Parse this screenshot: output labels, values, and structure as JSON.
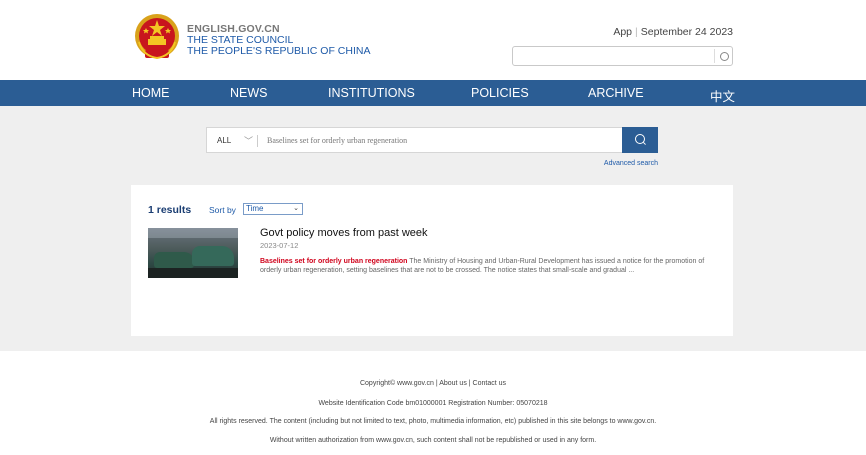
{
  "brand": {
    "site": "ENGLISH.GOV.CN",
    "line1": "THE STATE COUNCIL",
    "line2": "THE PEOPLE'S REPUBLIC OF CHINA"
  },
  "topbar": {
    "app_label": "App",
    "date": "September 24 2023",
    "search_placeholder": ""
  },
  "nav": {
    "items": [
      "HOME",
      "NEWS",
      "INSTITUTIONS",
      "POLICIES",
      "ARCHIVE",
      "中文"
    ]
  },
  "search": {
    "scope": "ALL",
    "query": "Baselines set for orderly urban regeneration",
    "advanced_label": "Advanced search"
  },
  "results": {
    "count_label": "1 results",
    "sort_label": "Sort by",
    "sort_value": "Time",
    "items": [
      {
        "title": "Govt policy moves from past week",
        "date": "2023-07-12",
        "highlight": "Baselines set for orderly urban regeneration",
        "snippet": " The Ministry of Housing and Urban-Rural Development has issued a notice for the promotion of orderly urban regeneration, setting baselines that are not to be crossed. The notice states that small-scale and gradual ..."
      }
    ]
  },
  "footer": {
    "line1": "Copyright© www.gov.cn | About us | Contact us",
    "line2": "Website Identification Code bm01000001     Registration Number: 05070218",
    "line3": "All rights reserved. The content (including but not limited to text, photo, multimedia information, etc) published in this site belongs to www.gov.cn.",
    "line4": "Without written authorization from www.gov.cn, such content shall not be republished or used in any form."
  },
  "colors": {
    "nav_bg": "#2b5d94",
    "brand_blue": "#1e5aa8",
    "highlight_red": "#d0021b",
    "page_gray": "#efefef"
  }
}
